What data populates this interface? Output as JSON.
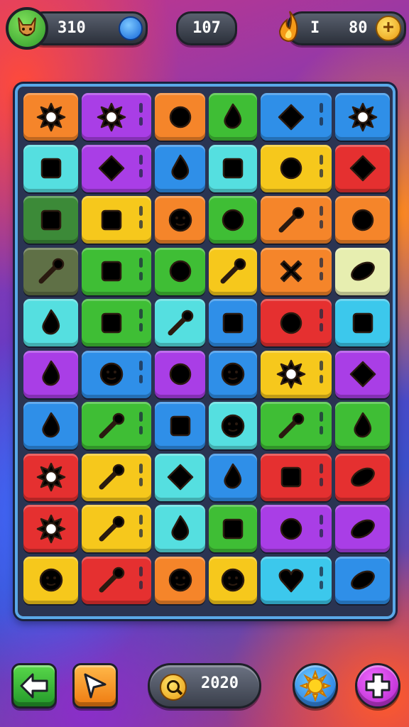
{
  "hud": {
    "player_score": "310",
    "moves": "107",
    "coins": "80",
    "fire_count": "I"
  },
  "bottom_bar": {
    "score": "2020"
  },
  "colors": {
    "orange": "#f5852a",
    "purple": "#a93ee6",
    "green": "#3fbe35",
    "blue": "#2f8fe8",
    "lightblue": "#3cc8ec",
    "cyan": "#55dfe0",
    "yellow": "#f6c81c",
    "red": "#e53030",
    "darkgreen": "#3c8a38",
    "olive": "#5f7046",
    "lime": "#a8e84a",
    "cream": "#e7eeb0"
  },
  "board": {
    "rows": [
      [
        {
          "color": "orange",
          "icon": "spiky-ball-icon",
          "marks": false
        },
        {
          "color": "purple",
          "icon": "gear-icon",
          "marks": true
        },
        {
          "color": "orange",
          "icon": "cloud-icon",
          "marks": false
        },
        {
          "color": "green",
          "icon": "nut-icon",
          "marks": false
        },
        {
          "color": "blue",
          "icon": "arrow-icon",
          "marks": true
        },
        {
          "color": "blue",
          "icon": "spiky-ball-icon",
          "marks": false
        }
      ],
      [
        {
          "color": "cyan",
          "icon": "film-icon",
          "marks": false
        },
        {
          "color": "purple",
          "icon": "diamond-icon",
          "marks": true
        },
        {
          "color": "blue",
          "icon": "funnel-icon",
          "marks": false
        },
        {
          "color": "cyan",
          "icon": "jar-icon",
          "marks": false
        },
        {
          "color": "yellow",
          "icon": "target-icon",
          "marks": true
        },
        {
          "color": "red",
          "icon": "sign-icon",
          "marks": false
        }
      ],
      [
        {
          "color": "darkgreen",
          "icon": "chest-icon",
          "marks": false
        },
        {
          "color": "yellow",
          "icon": "lock-icon",
          "marks": true
        },
        {
          "color": "orange",
          "icon": "bulb-icon",
          "marks": false
        },
        {
          "color": "green",
          "icon": "mushroom-icon",
          "marks": false
        },
        {
          "color": "orange",
          "icon": "hammer-icon",
          "marks": true
        },
        {
          "color": "orange",
          "icon": "bomb-icon",
          "marks": false
        }
      ],
      [
        {
          "color": "olive",
          "icon": "mallet-icon",
          "marks": false
        },
        {
          "color": "green",
          "icon": "crate-icon",
          "marks": true
        },
        {
          "color": "green",
          "icon": "globe-icon",
          "marks": false
        },
        {
          "color": "yellow",
          "icon": "wand-icon",
          "marks": false
        },
        {
          "color": "orange",
          "icon": "x-icon",
          "marks": true
        },
        {
          "color": "cream",
          "icon": "bread-icon",
          "marks": false
        }
      ],
      [
        {
          "color": "cyan",
          "icon": "star-blob-icon",
          "marks": false
        },
        {
          "color": "green",
          "icon": "cube-icon",
          "marks": true
        },
        {
          "color": "cyan",
          "icon": "key-icon",
          "marks": false
        },
        {
          "color": "blue",
          "icon": "phone-icon",
          "marks": false
        },
        {
          "color": "red",
          "icon": "lemon-icon",
          "marks": true
        },
        {
          "color": "lightblue",
          "icon": "pot-icon",
          "marks": false
        }
      ],
      [
        {
          "color": "purple",
          "icon": "acorn-icon",
          "marks": false
        },
        {
          "color": "blue",
          "icon": "smiley-icon",
          "marks": true
        },
        {
          "color": "purple",
          "icon": "ball-icon",
          "marks": false
        },
        {
          "color": "blue",
          "icon": "slime-icon",
          "marks": false
        },
        {
          "color": "yellow",
          "icon": "leaf-icon",
          "marks": true
        },
        {
          "color": "purple",
          "icon": "kite-icon",
          "marks": false
        }
      ],
      [
        {
          "color": "blue",
          "icon": "feather-icon",
          "marks": false
        },
        {
          "color": "green",
          "icon": "pencil-icon",
          "marks": true
        },
        {
          "color": "blue",
          "icon": "radio-icon",
          "marks": false
        },
        {
          "color": "cyan",
          "icon": "face-icon",
          "marks": false
        },
        {
          "color": "green",
          "icon": "rocket-icon",
          "marks": true
        },
        {
          "color": "green",
          "icon": "carrot-icon",
          "marks": false
        }
      ],
      [
        {
          "color": "red",
          "icon": "gear-eye-icon",
          "marks": false
        },
        {
          "color": "yellow",
          "icon": "pin-icon",
          "marks": true
        },
        {
          "color": "cyan",
          "icon": "crown-icon",
          "marks": false
        },
        {
          "color": "blue",
          "icon": "shield-icon",
          "marks": false
        },
        {
          "color": "red",
          "icon": "box-icon",
          "marks": true
        },
        {
          "color": "red",
          "icon": "scroll-icon",
          "marks": false
        }
      ],
      [
        {
          "color": "red",
          "icon": "badge-icon",
          "marks": false
        },
        {
          "color": "yellow",
          "icon": "axe-icon",
          "marks": true
        },
        {
          "color": "cyan",
          "icon": "duck-icon",
          "marks": false
        },
        {
          "color": "green",
          "icon": "battery-icon",
          "marks": false
        },
        {
          "color": "purple",
          "icon": "orb-icon",
          "marks": true
        },
        {
          "color": "purple",
          "icon": "bone-icon",
          "marks": false
        }
      ],
      [
        {
          "color": "yellow",
          "icon": "robot-icon",
          "marks": false
        },
        {
          "color": "red",
          "icon": "hook-icon",
          "marks": true
        },
        {
          "color": "orange",
          "icon": "grin-icon",
          "marks": false
        },
        {
          "color": "yellow",
          "icon": "monster-icon",
          "marks": false
        },
        {
          "color": "lightblue",
          "icon": "heart-icon",
          "marks": true
        },
        {
          "color": "blue",
          "icon": "rugby-ball-icon",
          "marks": false
        }
      ]
    ]
  }
}
